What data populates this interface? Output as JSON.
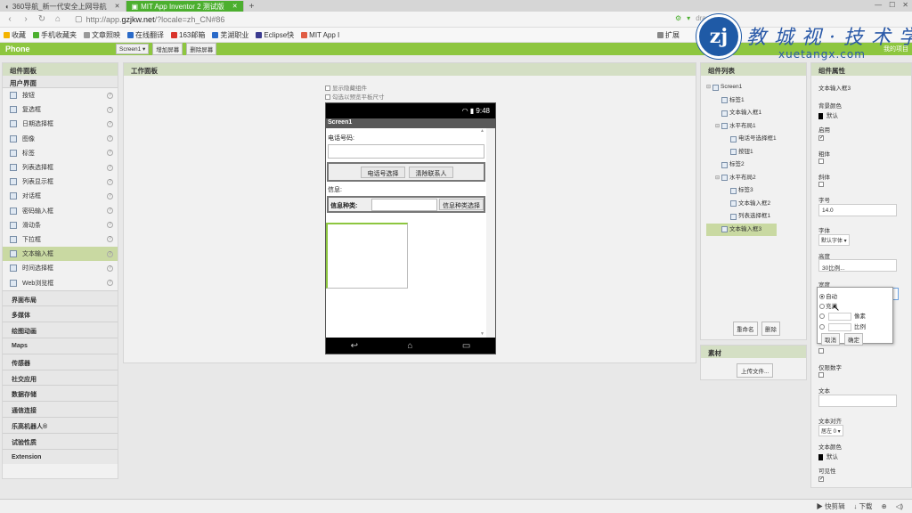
{
  "browser": {
    "tabs": [
      {
        "label": "360导航_新一代安全上网导航"
      },
      {
        "label": "MIT App Inventor 2 测试版"
      }
    ],
    "url_prefix": "http://app.",
    "url_domain": "gzjkw.net",
    "url_suffix": "/?locale=zh_CN#86",
    "bookmarks": [
      "收藏",
      "手机收藏夹",
      "文章照映",
      "在线翻译",
      "163邮箱",
      "芜湖职业",
      "Eclipse快",
      "MIT App I"
    ],
    "extensions": "扩展",
    "addr_right": "draw"
  },
  "logo": {
    "seal": "zj",
    "text": "教 城 视 · 技 术 学 院",
    "sub": "xuetangx.com"
  },
  "app": {
    "title": "Phone",
    "screen_select": "Screen1 ▾",
    "add_screen": "增加屏幕",
    "remove_screen": "删除屏幕",
    "header_right": "我的项目"
  },
  "palette": {
    "title": "组件面板",
    "section": "用户界面",
    "items": [
      "按钮",
      "复选框",
      "日期选择框",
      "图像",
      "标签",
      "列表选择框",
      "列表显示框",
      "对话框",
      "密码输入框",
      "滑动条",
      "下拉框",
      "文本输入框",
      "时间选择框",
      "Web浏览框"
    ],
    "selected_index": 11,
    "categories": [
      "界面布局",
      "多媒体",
      "绘图动画",
      "Maps",
      "传感器",
      "社交应用",
      "数据存储",
      "通信连接",
      "乐高机器人®",
      "试验性质",
      "Extension"
    ]
  },
  "viewer": {
    "title": "工作面板",
    "opt_hidden": "显示隐藏组件",
    "opt_tablet": "勾选以预览平板尺寸",
    "status_time": "9:48",
    "screen_title": "Screen1",
    "phone_label": "电话号码:",
    "pick_btn": "电话号选择",
    "clear_btn": "清除联系人",
    "msg_label": "信息:",
    "msg_type_label": "信息种类:",
    "msg_type_btn": "信息种类选择"
  },
  "components": {
    "title": "组件列表",
    "tree": [
      {
        "label": "Screen1",
        "level": 0
      },
      {
        "label": "标签1",
        "level": 1
      },
      {
        "label": "文本输入框1",
        "level": 1
      },
      {
        "label": "水平布局1",
        "level": 1
      },
      {
        "label": "电话号选择框1",
        "level": 2
      },
      {
        "label": "按钮1",
        "level": 2
      },
      {
        "label": "标签2",
        "level": 1
      },
      {
        "label": "水平布局2",
        "level": 1
      },
      {
        "label": "标签3",
        "level": 2
      },
      {
        "label": "文本输入框2",
        "level": 2
      },
      {
        "label": "列表选择框1",
        "level": 2
      },
      {
        "label": "文本输入框3",
        "level": 1
      }
    ],
    "rename": "重命名",
    "delete": "删除"
  },
  "media": {
    "title": "素材",
    "upload": "上传文件..."
  },
  "properties": {
    "title": "组件属性",
    "component": "文本输入框3",
    "bg_color_label": "背景颜色",
    "bg_color_value": "默认",
    "enabled_label": "启用",
    "bold_label": "粗体",
    "italic_label": "斜体",
    "fontsize_label": "字号",
    "fontsize_value": "14.0",
    "font_label": "字体",
    "font_value": "默认字体 ▾",
    "height_label": "高度",
    "height_value": "30比例...",
    "width_label": "宽度",
    "hint_only_num": "仅限数字",
    "text_label": "文本",
    "align_label": "文本对齐",
    "align_value": "居左 0 ▾",
    "text_color_label": "文本颜色",
    "text_color_value": "默认",
    "visible_label": "可见性"
  },
  "width_popup": {
    "auto": "自动",
    "fill": "充满",
    "pixels": "像素",
    "percent": "比例",
    "cancel": "取消",
    "ok": "确定"
  },
  "statusbar": {
    "speed": "快剪辑",
    "download": "下载"
  },
  "colors": {
    "accent": "#8dc63f",
    "tab_active": "#4caf2f",
    "selected": "#c9d9a2"
  }
}
